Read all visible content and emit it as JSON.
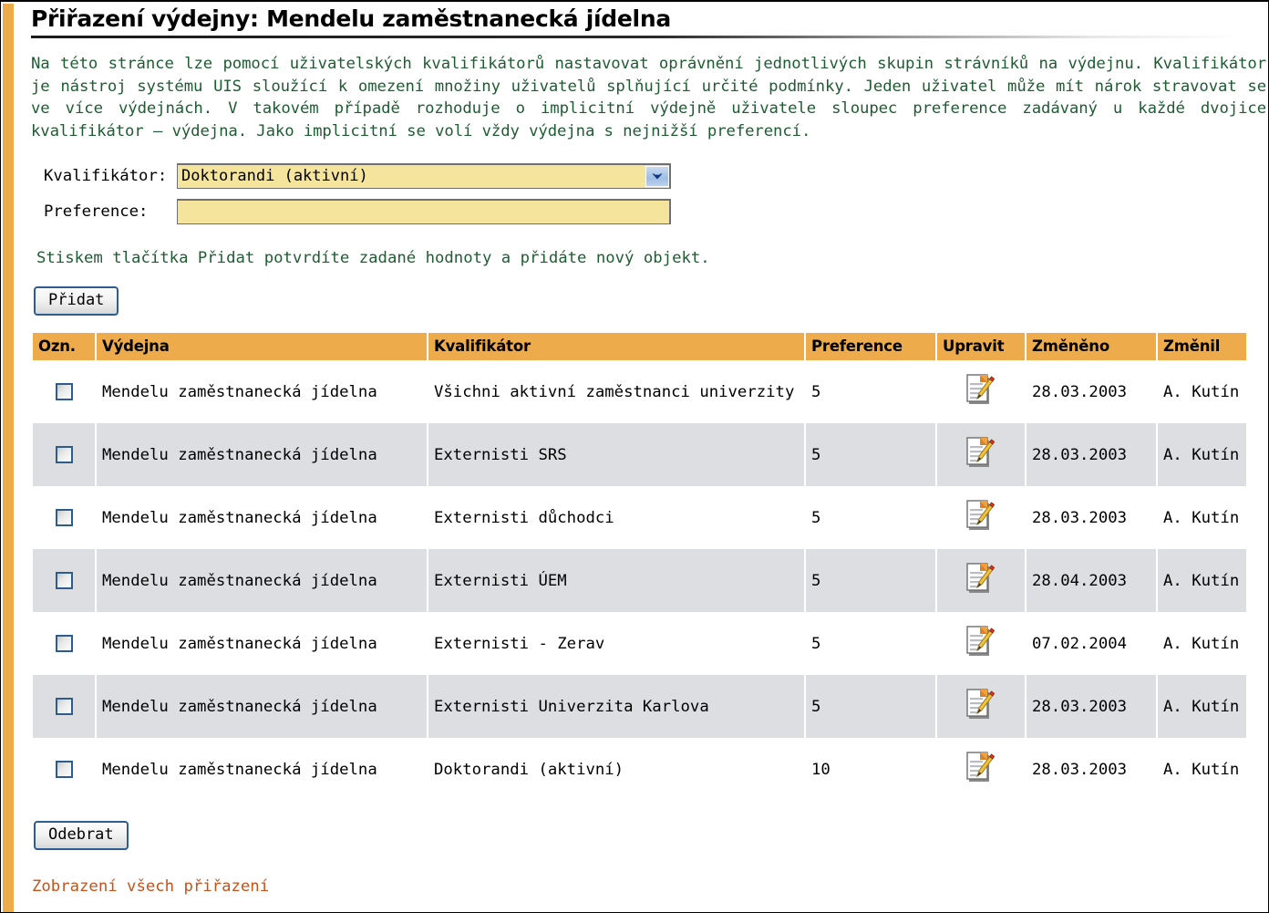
{
  "page": {
    "title": "Přiřazení výdejny: Mendelu zaměstnanecká jídelna",
    "intro": "Na této stránce lze pomocí uživatelských kvalifikátorů nastavovat oprávnění jednotlivých skupin strávníků na výdejnu. Kvalifikátor je nástroj systému UIS sloužící k omezení množiny uživatelů splňující určité podmínky. Jeden uživatel může mít nárok stravovat se ve více výdejnách. V takovém případě rozhoduje o implicitní výdejně uživatele sloupec preference zadávaný u každé dvojice kvalifikátor – výdejna. Jako implicitní se volí vždy výdejna s nejnižší preferencí.",
    "hint": "Stiskem tlačítka Přidat potvrdíte zadané hodnoty a přidáte nový objekt.",
    "bottom_link": "Zobrazení všech přiřazení"
  },
  "form": {
    "qualifier_label": "Kvalifikátor:",
    "qualifier_value": "Doktorandi (aktivní)",
    "qualifier_options": [
      "Doktorandi (aktivní)"
    ],
    "preference_label": "Preference:",
    "preference_value": "",
    "preference_placeholder": ""
  },
  "buttons": {
    "add": "Přidat",
    "remove": "Odebrat"
  },
  "table": {
    "headers": {
      "mark": "Ozn.",
      "canteen": "Výdejna",
      "qualifier": "Kvalifikátor",
      "preference": "Preference",
      "edit": "Upravit",
      "changed": "Změněno",
      "changed_by": "Změnil"
    },
    "rows": [
      {
        "canteen": "Mendelu zaměstnanecká jídelna",
        "qualifier": "Všichni aktivní zaměstnanci univerzity",
        "preference": "5",
        "edit_icon": "edit-document-pencil-icon",
        "changed": "28.03.2003",
        "changed_by": "A. Kutín"
      },
      {
        "canteen": "Mendelu zaměstnanecká jídelna",
        "qualifier": "Externisti SRS",
        "preference": "5",
        "edit_icon": "edit-document-pencil-icon",
        "changed": "28.03.2003",
        "changed_by": "A. Kutín"
      },
      {
        "canteen": "Mendelu zaměstnanecká jídelna",
        "qualifier": "Externisti důchodci",
        "preference": "5",
        "edit_icon": "edit-document-pencil-icon",
        "changed": "28.03.2003",
        "changed_by": "A. Kutín"
      },
      {
        "canteen": "Mendelu zaměstnanecká jídelna",
        "qualifier": "Externisti ÚEM",
        "preference": "5",
        "edit_icon": "edit-document-pencil-icon",
        "changed": "28.04.2003",
        "changed_by": "A. Kutín"
      },
      {
        "canteen": "Mendelu zaměstnanecká jídelna",
        "qualifier": "Externisti - Zerav",
        "preference": "5",
        "edit_icon": "edit-document-pencil-icon",
        "changed": "07.02.2004",
        "changed_by": "A. Kutín"
      },
      {
        "canteen": "Mendelu zaměstnanecká jídelna",
        "qualifier": "Externisti Univerzita Karlova",
        "preference": "5",
        "edit_icon": "edit-document-pencil-icon",
        "changed": "28.03.2003",
        "changed_by": "A. Kutín"
      },
      {
        "canteen": "Mendelu zaměstnanecká jídelna",
        "qualifier": "Doktorandi (aktivní)",
        "preference": "10",
        "edit_icon": "edit-document-pencil-icon",
        "changed": "28.03.2003",
        "changed_by": "A. Kutín"
      }
    ]
  },
  "colors": {
    "accent_orange": "#eeab4c",
    "link_orange": "#c4521b",
    "intro_green": "#1f5c33",
    "field_yellow": "#f5e49b",
    "row_alt_gray": "#dcdee1",
    "control_blue": "#2d5d8e"
  }
}
